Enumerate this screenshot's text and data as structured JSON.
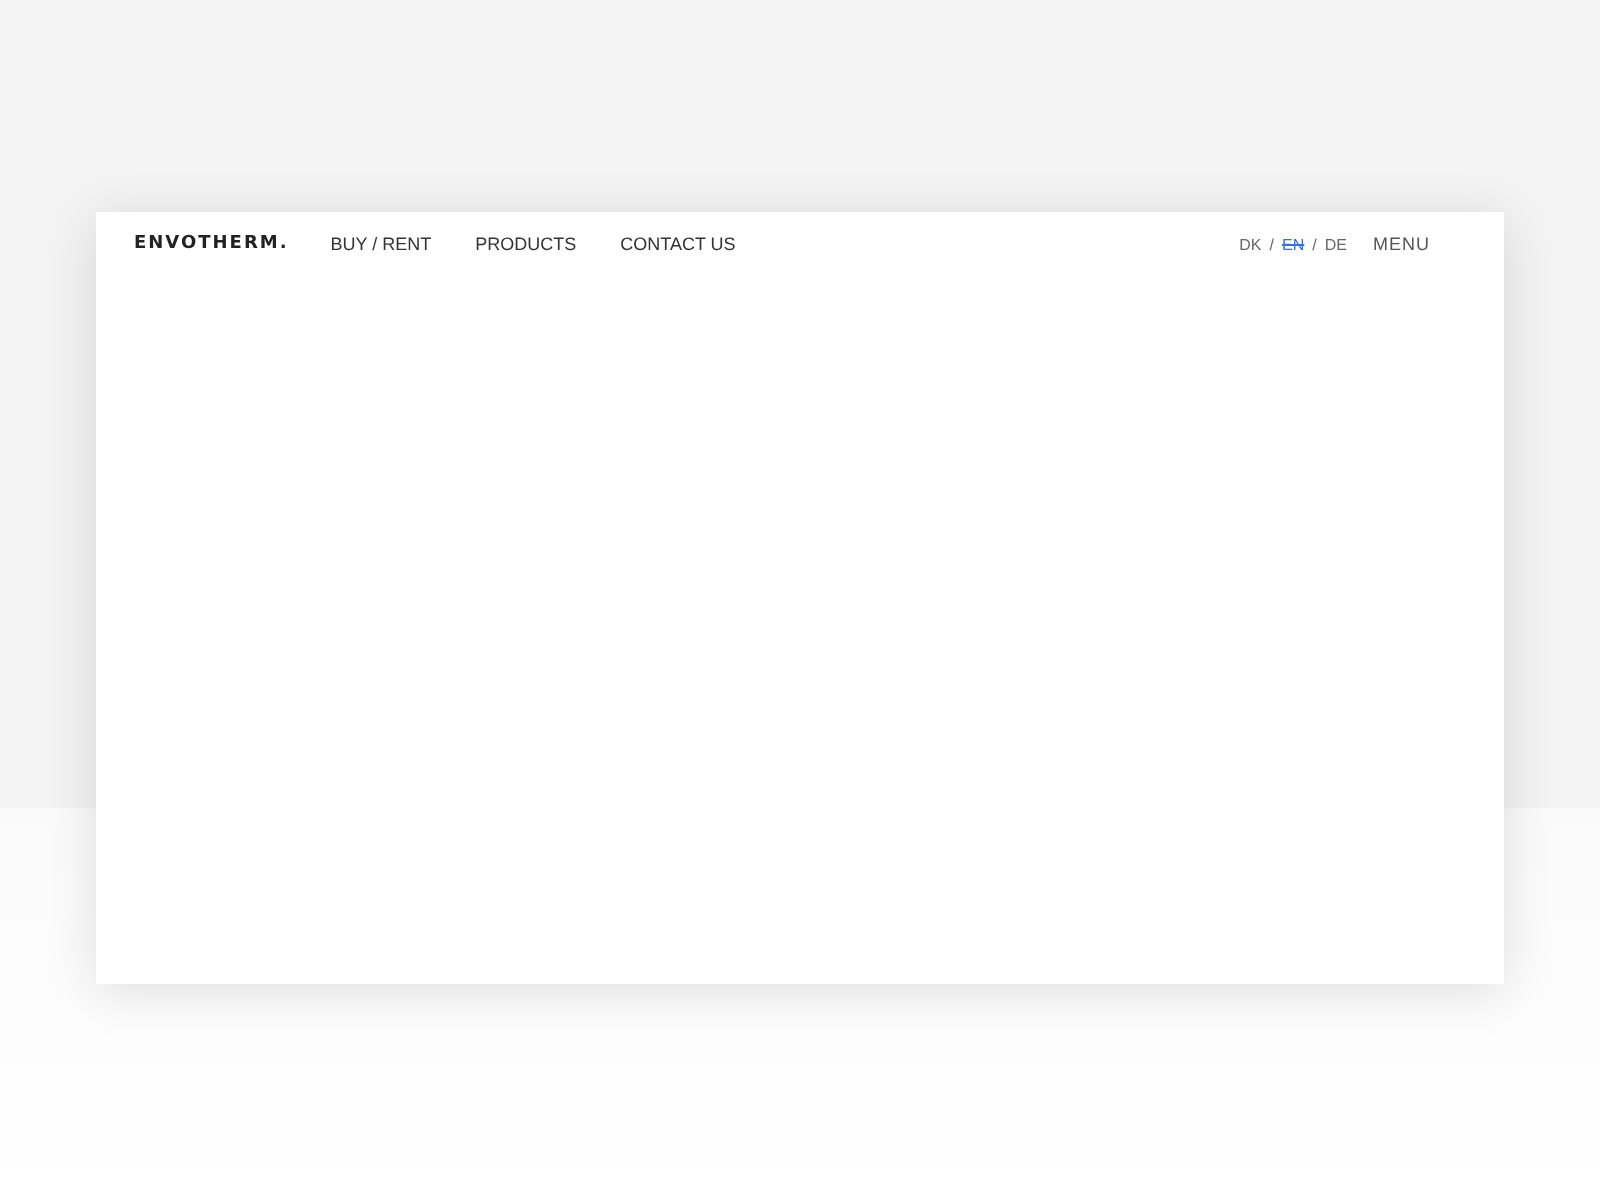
{
  "logo": "ENVOTHERM.",
  "nav": [
    "BUY / RENT",
    "PRODUCTS",
    "CONTACT US"
  ],
  "languages": [
    {
      "label": "DK",
      "selected": false
    },
    {
      "label": "EN",
      "selected": true
    },
    {
      "label": "DE",
      "selected": false
    }
  ],
  "language_separator": "/",
  "menu": "MENU"
}
